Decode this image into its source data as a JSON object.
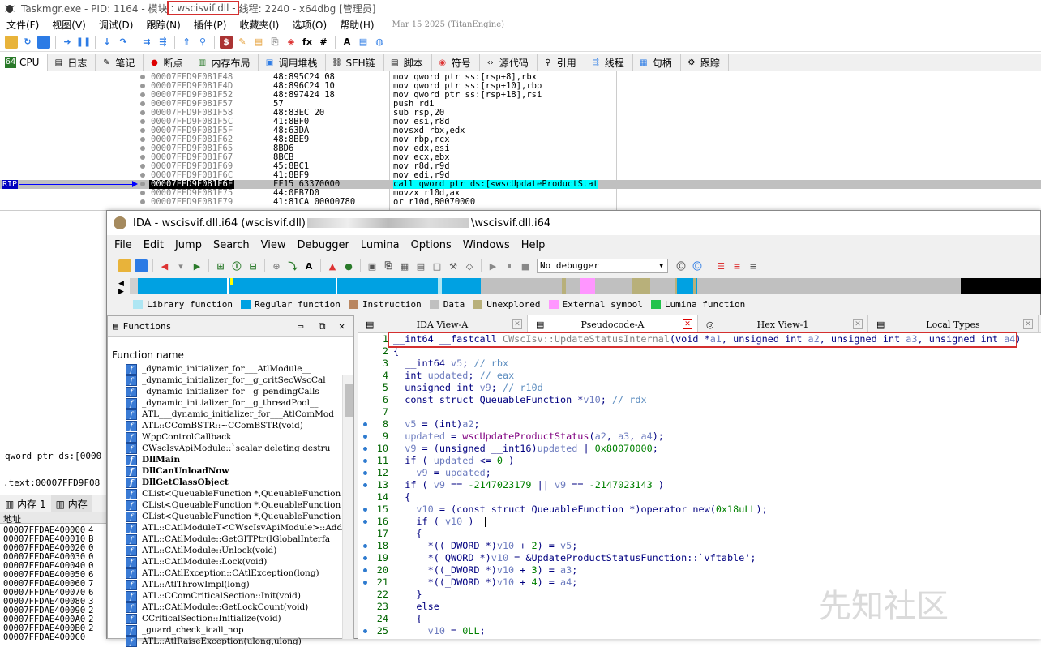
{
  "dbg": {
    "title_prefix": "Taskmgr.exe - PID: 1164 - 模块",
    "module": ": wscisvif.dll -",
    "title_suffix": " 线程: 2240 - x64dbg [管理员]",
    "menu": [
      "文件(F)",
      "视图(V)",
      "调试(D)",
      "跟踪(N)",
      "插件(P)",
      "收藏夹(I)",
      "选项(O)",
      "帮助(H)"
    ],
    "date": "Mar 15 2025 (TitanEngine)",
    "tabs": [
      "CPU",
      "日志",
      "笔记",
      "断点",
      "内存布局",
      "调用堆栈",
      "SEH链",
      "脚本",
      "符号",
      "源代码",
      "引用",
      "线程",
      "句柄",
      "跟踪"
    ],
    "rip_label": "RIP",
    "rows": [
      {
        "addr": "00007FFD9F081F48",
        "bytes": "48:895C24 08",
        "ins": "mov qword ptr ss:[rsp+8],rbx"
      },
      {
        "addr": "00007FFD9F081F4D",
        "bytes": "48:896C24 10",
        "ins": "mov qword ptr ss:[rsp+10],rbp"
      },
      {
        "addr": "00007FFD9F081F52",
        "bytes": "48:897424 18",
        "ins": "mov qword ptr ss:[rsp+18],rsi"
      },
      {
        "addr": "00007FFD9F081F57",
        "bytes": "57",
        "ins": "push rdi"
      },
      {
        "addr": "00007FFD9F081F58",
        "bytes": "48:83EC 20",
        "ins": "sub rsp,20"
      },
      {
        "addr": "00007FFD9F081F5C",
        "bytes": "41:8BF0",
        "ins": "mov esi,r8d"
      },
      {
        "addr": "00007FFD9F081F5F",
        "bytes": "48:63DA",
        "ins": "movsxd rbx,edx"
      },
      {
        "addr": "00007FFD9F081F62",
        "bytes": "48:8BE9",
        "ins": "mov rbp,rcx"
      },
      {
        "addr": "00007FFD9F081F65",
        "bytes": "8BD6",
        "ins": "mov edx,esi"
      },
      {
        "addr": "00007FFD9F081F67",
        "bytes": "8BCB",
        "ins": "mov ecx,ebx"
      },
      {
        "addr": "00007FFD9F081F69",
        "bytes": "45:8BC1",
        "ins": "mov r8d,r9d"
      },
      {
        "addr": "00007FFD9F081F6C",
        "bytes": "41:8BF9",
        "ins": "mov edi,r9d"
      },
      {
        "addr": "00007FFD9F081F6F",
        "bytes": "FF15 63370000",
        "ins": "call qword ptr ds:[<wscUpdateProductStat"
      },
      {
        "addr": "00007FFD9F081F75",
        "bytes": "44:0FB7D0",
        "ins": "movzx r10d,ax"
      },
      {
        "addr": "00007FFD9F081F79",
        "bytes": "41:81CA 00000780",
        "ins": "or r10d,80070000"
      }
    ],
    "info_line1": "qword ptr ds:[0000",
    "info_line2": ".text:00007FFD9F08",
    "mem_tabs": [
      "内存 1",
      "内存"
    ],
    "mem_header": "地址",
    "mem_rows": [
      {
        "addr": "00007FFDAE400000",
        "v": "4"
      },
      {
        "addr": "00007FFDAE400010",
        "v": "B"
      },
      {
        "addr": "00007FFDAE400020",
        "v": "0"
      },
      {
        "addr": "00007FFDAE400030",
        "v": "0"
      },
      {
        "addr": "00007FFDAE400040",
        "v": "0"
      },
      {
        "addr": "00007FFDAE400050",
        "v": "6"
      },
      {
        "addr": "00007FFDAE400060",
        "v": "7"
      },
      {
        "addr": "00007FFDAE400070",
        "v": "6"
      },
      {
        "addr": "00007FFDAE400080",
        "v": "3"
      },
      {
        "addr": "00007FFDAE400090",
        "v": "2"
      },
      {
        "addr": "00007FFDAE4000A0",
        "v": "2"
      },
      {
        "addr": "00007FFDAE4000B0",
        "v": "2"
      },
      {
        "addr": "00007FFDAE4000C0",
        "v": ""
      }
    ]
  },
  "ida": {
    "title_a": "IDA - wscisvif.dll.i64 (wscisvif.dll)",
    "title_b": "\\wscisvif.dll.i64",
    "menu": [
      "File",
      "Edit",
      "Jump",
      "Search",
      "View",
      "Debugger",
      "Lumina",
      "Options",
      "Windows",
      "Help"
    ],
    "debugger": "No debugger",
    "legend": [
      {
        "label": "Library function",
        "color": "#aee6f3"
      },
      {
        "label": "Regular function",
        "color": "#00a1e2"
      },
      {
        "label": "Instruction",
        "color": "#b98660"
      },
      {
        "label": "Data",
        "color": "#c0c0c0"
      },
      {
        "label": "Unexplored",
        "color": "#b8b07a"
      },
      {
        "label": "External symbol",
        "color": "#ff96ff"
      },
      {
        "label": "Lumina function",
        "color": "#22c34c"
      }
    ],
    "functions_title": "Functions",
    "functions_col": "Function name",
    "functions": [
      {
        "name": "_dynamic_initializer_for___AtlModule__",
        "bold": false
      },
      {
        "name": "_dynamic_initializer_for__g_critSecWscCal",
        "bold": false
      },
      {
        "name": "_dynamic_initializer_for__g_pendingCalls_",
        "bold": false
      },
      {
        "name": "_dynamic_initializer_for__g_threadPool__",
        "bold": false
      },
      {
        "name": "ATL___dynamic_initializer_for___AtlComMod",
        "bold": false
      },
      {
        "name": "ATL::CComBSTR::~CComBSTR(void)",
        "bold": false
      },
      {
        "name": "WppControlCallback",
        "bold": false
      },
      {
        "name": "CWscIsvApiModule::`scalar deleting destru",
        "bold": false
      },
      {
        "name": "DllMain",
        "bold": true
      },
      {
        "name": "DllCanUnloadNow",
        "bold": true
      },
      {
        "name": "DllGetClassObject",
        "bold": true
      },
      {
        "name": "CList<QueuableFunction *,QueuableFunction",
        "bold": false
      },
      {
        "name": "CList<QueuableFunction *,QueuableFunction",
        "bold": false
      },
      {
        "name": "CList<QueuableFunction *,QueuableFunction",
        "bold": false
      },
      {
        "name": "ATL::CAtlModuleT<CWscIsvApiModule>::AddCo",
        "bold": false
      },
      {
        "name": "ATL::CAtlModule::GetGITPtr(IGlobalInterfa",
        "bold": false
      },
      {
        "name": "ATL::CAtlModule::Unlock(void)",
        "bold": false
      },
      {
        "name": "ATL::CAtlModule::Lock(void)",
        "bold": false
      },
      {
        "name": "ATL::CAtlException::CAtlException(long)",
        "bold": false
      },
      {
        "name": "ATL::AtlThrowImpl(long)",
        "bold": false
      },
      {
        "name": "ATL::CComCriticalSection::Init(void)",
        "bold": false
      },
      {
        "name": "ATL::CAtlModule::GetLockCount(void)",
        "bold": false
      },
      {
        "name": "CCriticalSection::Initialize(void)",
        "bold": false
      },
      {
        "name": "_guard_check_icall_nop",
        "bold": false
      },
      {
        "name": "ATL::AtlRaiseException(ulong,ulong)",
        "bold": false
      }
    ],
    "tabs": [
      "IDA View-A",
      "Pseudocode-A",
      "Hex View-1",
      "Local Types"
    ],
    "code": [
      {
        "n": "1",
        "bp": false,
        "t": "__int64 __fastcall CWscIsv::UpdateStatusInternal(void *a1, unsigned int a2, unsigned int a3, unsigned int a4)"
      },
      {
        "n": "2",
        "bp": false,
        "t": "{"
      },
      {
        "n": "3",
        "bp": false,
        "t": "  __int64 v5; // rbx"
      },
      {
        "n": "4",
        "bp": false,
        "t": "  int updated; // eax"
      },
      {
        "n": "5",
        "bp": false,
        "t": "  unsigned int v9; // r10d"
      },
      {
        "n": "6",
        "bp": false,
        "t": "  const struct QueuableFunction *v10; // rdx"
      },
      {
        "n": "7",
        "bp": false,
        "t": ""
      },
      {
        "n": "8",
        "bp": true,
        "t": "  v5 = (int)a2;"
      },
      {
        "n": "9",
        "bp": true,
        "t": "  updated = wscUpdateProductStatus(a2, a3, a4);"
      },
      {
        "n": "10",
        "bp": true,
        "t": "  v9 = (unsigned __int16)updated | 0x80070000;"
      },
      {
        "n": "11",
        "bp": true,
        "t": "  if ( updated <= 0 )"
      },
      {
        "n": "12",
        "bp": true,
        "t": "    v9 = updated;"
      },
      {
        "n": "13",
        "bp": true,
        "t": "  if ( v9 == -2147023179 || v9 == -2147023143 )"
      },
      {
        "n": "14",
        "bp": false,
        "t": "  {"
      },
      {
        "n": "15",
        "bp": true,
        "t": "    v10 = (const struct QueuableFunction *)operator new(0x18uLL);"
      },
      {
        "n": "16",
        "bp": true,
        "t": "    if ( v10 )"
      },
      {
        "n": "17",
        "bp": false,
        "t": "    {"
      },
      {
        "n": "18",
        "bp": true,
        "t": "      *((_DWORD *)v10 + 2) = v5;"
      },
      {
        "n": "19",
        "bp": true,
        "t": "      *(_QWORD *)v10 = &UpdateProductStatusFunction::`vftable';"
      },
      {
        "n": "20",
        "bp": true,
        "t": "      *((_DWORD *)v10 + 3) = a3;"
      },
      {
        "n": "21",
        "bp": true,
        "t": "      *((_DWORD *)v10 + 4) = a4;"
      },
      {
        "n": "22",
        "bp": false,
        "t": "    }"
      },
      {
        "n": "23",
        "bp": false,
        "t": "    else"
      },
      {
        "n": "24",
        "bp": false,
        "t": "    {"
      },
      {
        "n": "25",
        "bp": true,
        "t": "      v10 = 0LL;"
      }
    ]
  },
  "watermark": "先知社区"
}
